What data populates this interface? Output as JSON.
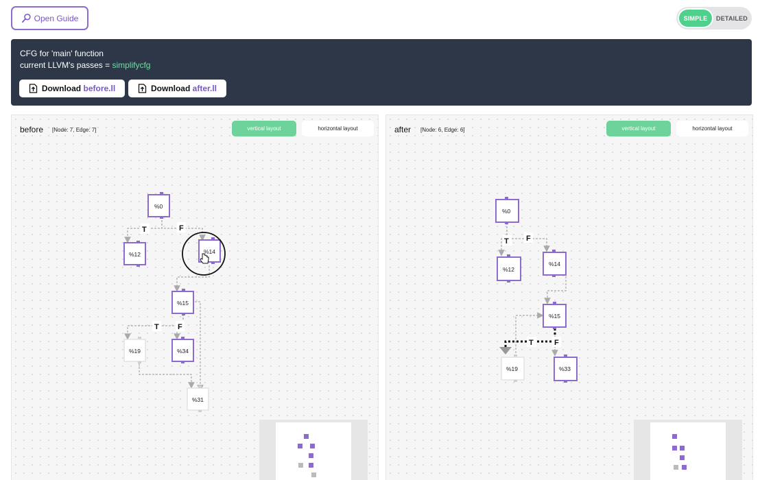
{
  "header": {
    "guide_label": "Open Guide",
    "mode_simple": "SIMPLE",
    "mode_detailed": "DETAILED"
  },
  "banner": {
    "line1": "CFG for 'main' function",
    "line2_prefix": "current LLVM's passes = ",
    "line2_pass": "simplifycfg",
    "download_before_prefix": "Download ",
    "download_before_file": "before.ll",
    "download_after_prefix": "Download ",
    "download_after_file": "after.ll"
  },
  "colors": {
    "accent_purple": "#8c6ad0",
    "accent_green": "#4fd08d",
    "banner_bg": "#2d3748"
  },
  "panels": {
    "before": {
      "title": "before",
      "stats": "[Node: 7, Edge: 7]",
      "vertical_label": "vertical layout",
      "horizontal_label": "horizontal layout",
      "nodes": [
        "%0",
        "%12",
        "%14",
        "%15",
        "%19",
        "%34",
        "%31"
      ],
      "edge_labels": [
        "T",
        "F",
        "T",
        "F"
      ]
    },
    "after": {
      "title": "after",
      "stats": "[Node: 6, Edge: 6]",
      "vertical_label": "vertical layout",
      "horizontal_label": "horizontal layout",
      "nodes": [
        "%0",
        "%12",
        "%14",
        "%15",
        "%19",
        "%33"
      ],
      "edge_labels": [
        "T",
        "F",
        "T",
        "F"
      ]
    }
  },
  "icons": {
    "guide": "magnifier-icon",
    "download": "upload-file-icon",
    "cursor": "hand-pointer-icon"
  }
}
